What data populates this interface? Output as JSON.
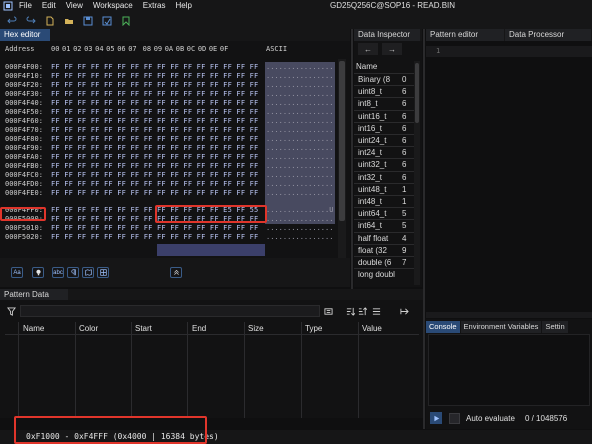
{
  "menubar": {
    "items": [
      "File",
      "Edit",
      "View",
      "Workspace",
      "Extras",
      "Help"
    ],
    "window_title": "GD25Q256C@SOP16 - READ.BIN"
  },
  "toolbar": {
    "icons": [
      "undo-icon",
      "redo-icon",
      "new-file-icon",
      "open-file-icon",
      "save-icon",
      "save-as-icon",
      "bookmark-icon"
    ]
  },
  "tabs": {
    "hex_editor": "Hex editor",
    "data_inspector": "Data Inspector",
    "pattern_editor": "Pattern editor",
    "data_processor": "Data Processor",
    "pattern_data": "Pattern Data"
  },
  "hex_editor": {
    "header_address": "Address",
    "header_columns": [
      "00",
      "01",
      "02",
      "03",
      "04",
      "05",
      "06",
      "07",
      "08",
      "09",
      "0A",
      "0B",
      "0C",
      "0D",
      "0E",
      "0F"
    ],
    "header_ascii": "ASCII",
    "rows": [
      {
        "addr": "000F4F00:",
        "bytes": "FF FF FF FF FF FF FF FF  FF FF FF FF FF FF FF FF",
        "ascii": "................"
      },
      {
        "addr": "000F4F10:",
        "bytes": "FF FF FF FF FF FF FF FF  FF FF FF FF FF FF FF FF",
        "ascii": "................"
      },
      {
        "addr": "000F4F20:",
        "bytes": "FF FF FF FF FF FF FF FF  FF FF FF FF FF FF FF FF",
        "ascii": "................"
      },
      {
        "addr": "000F4F30:",
        "bytes": "FF FF FF FF FF FF FF FF  FF FF FF FF FF FF FF FF",
        "ascii": "................"
      },
      {
        "addr": "000F4F40:",
        "bytes": "FF FF FF FF FF FF FF FF  FF FF FF FF FF FF FF FF",
        "ascii": "................"
      },
      {
        "addr": "000F4F50:",
        "bytes": "FF FF FF FF FF FF FF FF  FF FF FF FF FF FF FF FF",
        "ascii": "................"
      },
      {
        "addr": "000F4F60:",
        "bytes": "FF FF FF FF FF FF FF FF  FF FF FF FF FF FF FF FF",
        "ascii": "................"
      },
      {
        "addr": "000F4F70:",
        "bytes": "FF FF FF FF FF FF FF FF  FF FF FF FF FF FF FF FF",
        "ascii": "................"
      },
      {
        "addr": "000F4F80:",
        "bytes": "FF FF FF FF FF FF FF FF  FF FF FF FF FF FF FF FF",
        "ascii": "................"
      },
      {
        "addr": "000F4F90:",
        "bytes": "FF FF FF FF FF FF FF FF  FF FF FF FF FF FF FF FF",
        "ascii": "................"
      },
      {
        "addr": "000F4FA0:",
        "bytes": "FF FF FF FF FF FF FF FF  FF FF FF FF FF FF FF FF",
        "ascii": "................"
      },
      {
        "addr": "000F4FB0:",
        "bytes": "FF FF FF FF FF FF FF FF  FF FF FF FF FF FF FF FF",
        "ascii": "................"
      },
      {
        "addr": "000F4FC0:",
        "bytes": "FF FF FF FF FF FF FF FF  FF FF FF FF FF FF FF FF",
        "ascii": "................"
      },
      {
        "addr": "000F4FD0:",
        "bytes": "FF FF FF FF FF FF FF FF  FF FF FF FF FF FF FF FF",
        "ascii": "................"
      },
      {
        "addr": "000F4FE0:",
        "bytes": "FF FF FF FF FF FF FF FF  FF FF FF FF FF FF FF FF",
        "ascii": "................"
      },
      {
        "addr": "000F4FF0:",
        "bytes": "FF FF FF FF FF FF FF FF  FF FF FF FF FF E5 FF 55",
        "ascii": "...............U"
      },
      {
        "addr": "000F5000:",
        "bytes": "FF FF FF FF FF FF FF FF  FF FF FF FF FF FF FF FF",
        "ascii": "................"
      },
      {
        "addr": "000F5010:",
        "bytes": "FF FF FF FF FF FF FF FF  FF FF FF FF FF FF FF FF",
        "ascii": "................"
      },
      {
        "addr": "000F5020:",
        "bytes": "FF FF FF FF FF FF FF FF  FF FF FF FF FF FF FF FF",
        "ascii": "................"
      }
    ],
    "footer_buttons": [
      "Aa",
      "bulb",
      "abc",
      "pilcrow",
      "map",
      "grid",
      "up"
    ]
  },
  "data_inspector": {
    "header": "Name",
    "rows": [
      {
        "name": "Binary (8",
        "value": "0"
      },
      {
        "name": "uint8_t",
        "value": "6"
      },
      {
        "name": "int8_t",
        "value": "6"
      },
      {
        "name": "uint16_t",
        "value": "6"
      },
      {
        "name": "int16_t",
        "value": "6"
      },
      {
        "name": "uint24_t",
        "value": "6"
      },
      {
        "name": "int24_t",
        "value": "6"
      },
      {
        "name": "uint32_t",
        "value": "6"
      },
      {
        "name": "int32_t",
        "value": "6"
      },
      {
        "name": "uint48_t",
        "value": "1"
      },
      {
        "name": "int48_t",
        "value": "1"
      },
      {
        "name": "uint64_t",
        "value": "5"
      },
      {
        "name": "int64_t",
        "value": "5"
      },
      {
        "name": "half float",
        "value": "4"
      },
      {
        "name": "float (32",
        "value": "9"
      },
      {
        "name": "double (6",
        "value": "7"
      },
      {
        "name": "long doubl",
        "value": ""
      }
    ]
  },
  "pattern_editor": {
    "line_number": "1"
  },
  "pattern_data": {
    "columns": [
      "Name",
      "Color",
      "Start",
      "End",
      "Size",
      "Type",
      "Value"
    ]
  },
  "console": {
    "tabs": [
      "Console",
      "Environment Variables",
      "Settin"
    ],
    "auto_evaluate_label": "Auto evaluate",
    "progress": "0 / 1048576"
  },
  "statusbar": {
    "selection": "0xF1000 - 0xF4FFF (0x4000 | 16384 bytes)"
  },
  "colors": {
    "accent": "#2a4a76",
    "highlight_box": "#e0352b",
    "hex_text": "#b9c4f2",
    "ascii_selection": "#5b5d7b"
  }
}
